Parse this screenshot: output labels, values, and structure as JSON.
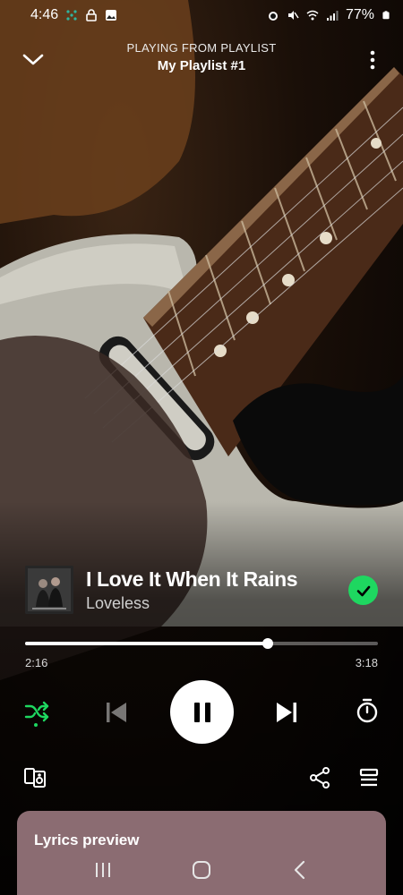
{
  "status_bar": {
    "time": "4:46",
    "battery": "77%",
    "icons_left": [
      "dots-app-icon",
      "lock-icon",
      "gallery-icon"
    ],
    "icons_right": [
      "alarm-icon",
      "mute-icon",
      "wifi-icon",
      "signal-icon",
      "battery-icon"
    ]
  },
  "header": {
    "label": "PLAYING FROM PLAYLIST",
    "playlist_name": "My Playlist #1"
  },
  "track": {
    "title": "I Love It When It Rains",
    "artist": "Loveless",
    "liked": true
  },
  "progress": {
    "elapsed": "2:16",
    "duration": "3:18",
    "fraction": 0.687
  },
  "controls": {
    "shuffle_active": true,
    "state": "playing"
  },
  "lyrics": {
    "title": "Lyrics preview"
  },
  "colors": {
    "accent": "#1ed760",
    "lyrics_card": "#8b6c72"
  }
}
